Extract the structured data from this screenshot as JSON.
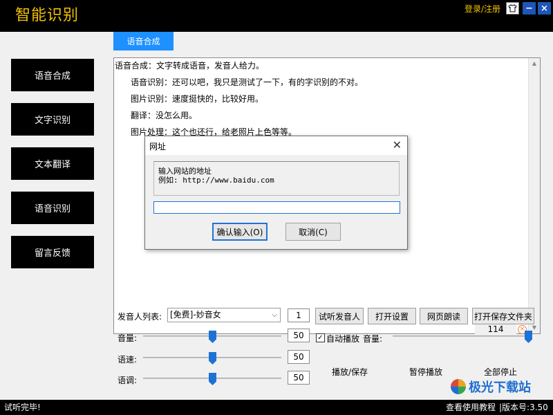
{
  "app": {
    "title": "智能识别",
    "login_link": "登录/注册",
    "minimize_glyph": "−",
    "close_glyph": "×",
    "skin_icon": "shirt-icon"
  },
  "sidebar": {
    "items": [
      {
        "label": "语音合成"
      },
      {
        "label": "文字识别"
      },
      {
        "label": "文本翻译"
      },
      {
        "label": "语音识别"
      },
      {
        "label": "留言反馈"
      }
    ]
  },
  "tab": {
    "label": "语音合成"
  },
  "editor": {
    "lines": [
      "语音合成：文字转成语音，发音人给力。",
      "语音识别：还可以吧，我只是测试了一下，有的字识别的不对。",
      "图片识别：速度挺快的，比较好用。",
      "翻译：没怎么用。",
      "图片处理：这个也还行，给老照片上色等等。"
    ],
    "char_count": "114",
    "clear_glyph": "×"
  },
  "controls": {
    "speaker_label": "发音人列表:",
    "speaker_selected": "[免费]-妙音女",
    "speaker_count": "1",
    "volume_label": "音量:",
    "volume_value": "50",
    "volume_level": 0.5,
    "speed_label": "语速:",
    "speed_value": "50",
    "speed_level": 0.5,
    "pitch_label": "语调:",
    "pitch_value": "50",
    "pitch_level": 0.5,
    "buttons": {
      "preview_speaker": "试听发音人",
      "open_settings": "打开设置",
      "web_read": "网页朗读",
      "open_save_folder": "打开保存文件夹"
    },
    "autoplay_label": "自动播放",
    "autoplay_checked": true,
    "playback_volume_label": "音量:",
    "playback_volume_level": 1.0,
    "play_save": "播放/保存",
    "pause": "暂停播放",
    "stop_all": "全部停止"
  },
  "status": {
    "message": "试听完毕!",
    "help_link": "查看使用教程",
    "version": "|版本号:3.50",
    "watermark": "极光下载站"
  },
  "dialog": {
    "title": "网址",
    "hint_line1": "输入网站的地址",
    "hint_line2": "例如: http://www.baidu.com",
    "input_value": "",
    "confirm": "确认输入(O)",
    "cancel": "取消(C)"
  },
  "colors": {
    "accent_yellow": "#f2c200",
    "tab_blue": "#1e90ff",
    "slider_blue": "#1e72d6",
    "title_button_blue": "#1e56b8"
  }
}
